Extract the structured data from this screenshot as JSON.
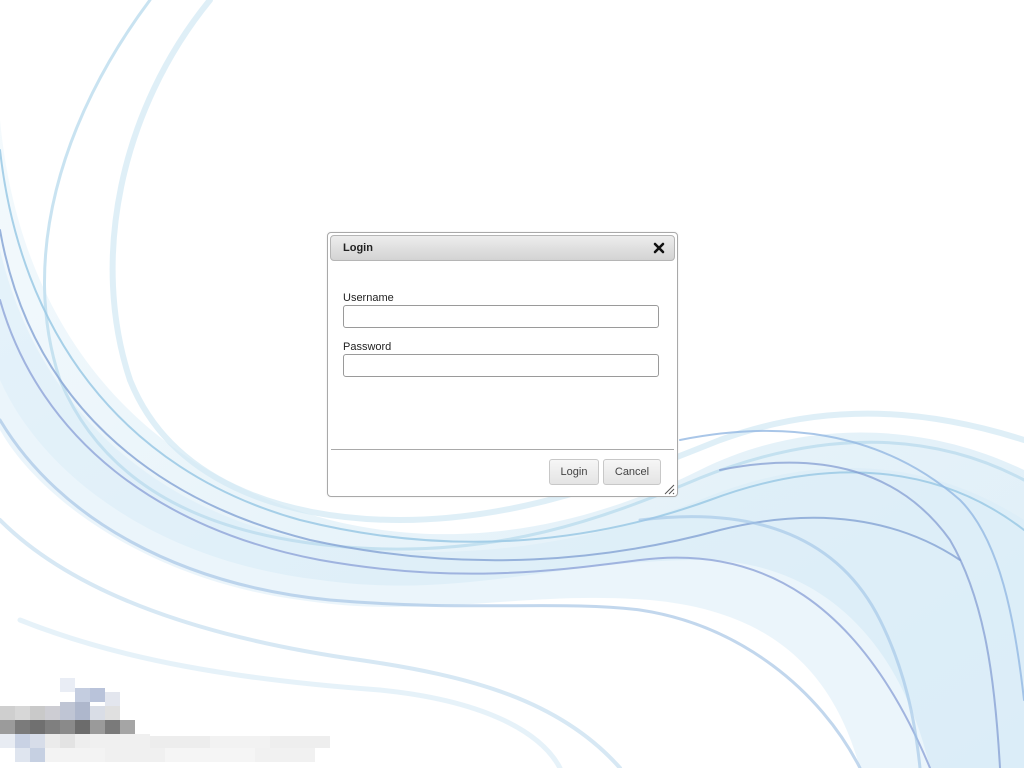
{
  "dialog": {
    "title": "Login",
    "close_icon": "close-icon",
    "username_label": "Username",
    "username_value": "",
    "password_label": "Password",
    "password_value": "",
    "login_button": "Login",
    "cancel_button": "Cancel",
    "resize_icon": "resize-grip-icon"
  },
  "desktop": {
    "wallpaper": "blue-swirl-wallpaper",
    "logo": "pixelated-logo"
  },
  "colors": {
    "background": "#ffffff",
    "wave_light": "#cfe6f3",
    "wave_mid": "#9fcbe6",
    "wave_dark": "#8a9fd2",
    "titlebar_top": "#ededed",
    "titlebar_bottom": "#d3d3d3",
    "border": "#a9a9a9"
  }
}
